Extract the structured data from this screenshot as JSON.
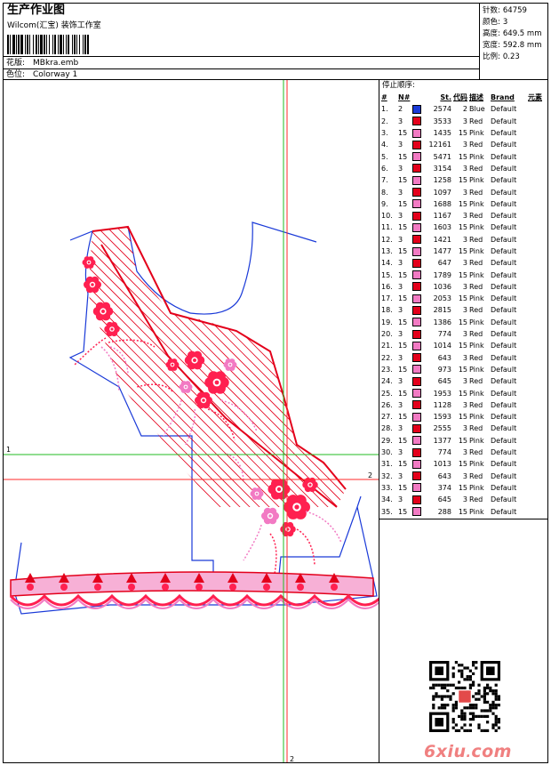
{
  "header": {
    "title": "生产作业图",
    "subtitle": "Wilcom(汇宝) 装饰工作室",
    "design_label": "花版:",
    "design_value": "MBkra.emb",
    "colorway_label": "色位:",
    "colorway_value": "Colorway 1"
  },
  "stats": {
    "stitches_label": "针数:",
    "stitches_value": "64759",
    "colors_label": "颜色:",
    "colors_value": "3",
    "height_label": "高度:",
    "height_value": "649.5 mm",
    "width_label": "宽度:",
    "width_value": "592.8 mm",
    "scale_label": "比例:",
    "scale_value": "0.23"
  },
  "canvas": {
    "guide_h_label": "1",
    "guide_h2_label": "2",
    "guide_v_label": "2"
  },
  "stop_sequence": {
    "label": "停止顺序:",
    "headers": [
      "#",
      "N#",
      "St.",
      "代码",
      "描述",
      "Brand",
      "元素"
    ],
    "colors": {
      "Blue": "#1a3ad8",
      "Red": "#e3001b",
      "Pink": "#f27ac3"
    },
    "rows": [
      {
        "idx": "1.",
        "n": "2",
        "st": "2574",
        "code": "2",
        "desc": "Blue",
        "brand": "Default"
      },
      {
        "idx": "2.",
        "n": "3",
        "st": "3533",
        "code": "3",
        "desc": "Red",
        "brand": "Default"
      },
      {
        "idx": "3.",
        "n": "15",
        "st": "1435",
        "code": "15",
        "desc": "Pink",
        "brand": "Default"
      },
      {
        "idx": "4.",
        "n": "3",
        "st": "12161",
        "code": "3",
        "desc": "Red",
        "brand": "Default"
      },
      {
        "idx": "5.",
        "n": "15",
        "st": "5471",
        "code": "15",
        "desc": "Pink",
        "brand": "Default"
      },
      {
        "idx": "6.",
        "n": "3",
        "st": "3154",
        "code": "3",
        "desc": "Red",
        "brand": "Default"
      },
      {
        "idx": "7.",
        "n": "15",
        "st": "1258",
        "code": "15",
        "desc": "Pink",
        "brand": "Default"
      },
      {
        "idx": "8.",
        "n": "3",
        "st": "1097",
        "code": "3",
        "desc": "Red",
        "brand": "Default"
      },
      {
        "idx": "9.",
        "n": "15",
        "st": "1688",
        "code": "15",
        "desc": "Pink",
        "brand": "Default"
      },
      {
        "idx": "10.",
        "n": "3",
        "st": "1167",
        "code": "3",
        "desc": "Red",
        "brand": "Default"
      },
      {
        "idx": "11.",
        "n": "15",
        "st": "1603",
        "code": "15",
        "desc": "Pink",
        "brand": "Default"
      },
      {
        "idx": "12.",
        "n": "3",
        "st": "1421",
        "code": "3",
        "desc": "Red",
        "brand": "Default"
      },
      {
        "idx": "13.",
        "n": "15",
        "st": "1477",
        "code": "15",
        "desc": "Pink",
        "brand": "Default"
      },
      {
        "idx": "14.",
        "n": "3",
        "st": "647",
        "code": "3",
        "desc": "Red",
        "brand": "Default"
      },
      {
        "idx": "15.",
        "n": "15",
        "st": "1789",
        "code": "15",
        "desc": "Pink",
        "brand": "Default"
      },
      {
        "idx": "16.",
        "n": "3",
        "st": "1036",
        "code": "3",
        "desc": "Red",
        "brand": "Default"
      },
      {
        "idx": "17.",
        "n": "15",
        "st": "2053",
        "code": "15",
        "desc": "Pink",
        "brand": "Default"
      },
      {
        "idx": "18.",
        "n": "3",
        "st": "2815",
        "code": "3",
        "desc": "Red",
        "brand": "Default"
      },
      {
        "idx": "19.",
        "n": "15",
        "st": "1386",
        "code": "15",
        "desc": "Pink",
        "brand": "Default"
      },
      {
        "idx": "20.",
        "n": "3",
        "st": "774",
        "code": "3",
        "desc": "Red",
        "brand": "Default"
      },
      {
        "idx": "21.",
        "n": "15",
        "st": "1014",
        "code": "15",
        "desc": "Pink",
        "brand": "Default"
      },
      {
        "idx": "22.",
        "n": "3",
        "st": "643",
        "code": "3",
        "desc": "Red",
        "brand": "Default"
      },
      {
        "idx": "23.",
        "n": "15",
        "st": "973",
        "code": "15",
        "desc": "Pink",
        "brand": "Default"
      },
      {
        "idx": "24.",
        "n": "3",
        "st": "645",
        "code": "3",
        "desc": "Red",
        "brand": "Default"
      },
      {
        "idx": "25.",
        "n": "15",
        "st": "1953",
        "code": "15",
        "desc": "Pink",
        "brand": "Default"
      },
      {
        "idx": "26.",
        "n": "3",
        "st": "1128",
        "code": "3",
        "desc": "Red",
        "brand": "Default"
      },
      {
        "idx": "27.",
        "n": "15",
        "st": "1593",
        "code": "15",
        "desc": "Pink",
        "brand": "Default"
      },
      {
        "idx": "28.",
        "n": "3",
        "st": "2555",
        "code": "3",
        "desc": "Red",
        "brand": "Default"
      },
      {
        "idx": "29.",
        "n": "15",
        "st": "1377",
        "code": "15",
        "desc": "Pink",
        "brand": "Default"
      },
      {
        "idx": "30.",
        "n": "3",
        "st": "774",
        "code": "3",
        "desc": "Red",
        "brand": "Default"
      },
      {
        "idx": "31.",
        "n": "15",
        "st": "1013",
        "code": "15",
        "desc": "Pink",
        "brand": "Default"
      },
      {
        "idx": "32.",
        "n": "3",
        "st": "643",
        "code": "3",
        "desc": "Red",
        "brand": "Default"
      },
      {
        "idx": "33.",
        "n": "15",
        "st": "374",
        "code": "15",
        "desc": "Pink",
        "brand": "Default"
      },
      {
        "idx": "34.",
        "n": "3",
        "st": "645",
        "code": "3",
        "desc": "Red",
        "brand": "Default"
      },
      {
        "idx": "35.",
        "n": "15",
        "st": "288",
        "code": "15",
        "desc": "Pink",
        "brand": "Default"
      }
    ]
  },
  "watermark": {
    "site": "6xiu",
    "dot": ".",
    "tld": "com",
    "qr_icon": "qr-code-icon"
  }
}
